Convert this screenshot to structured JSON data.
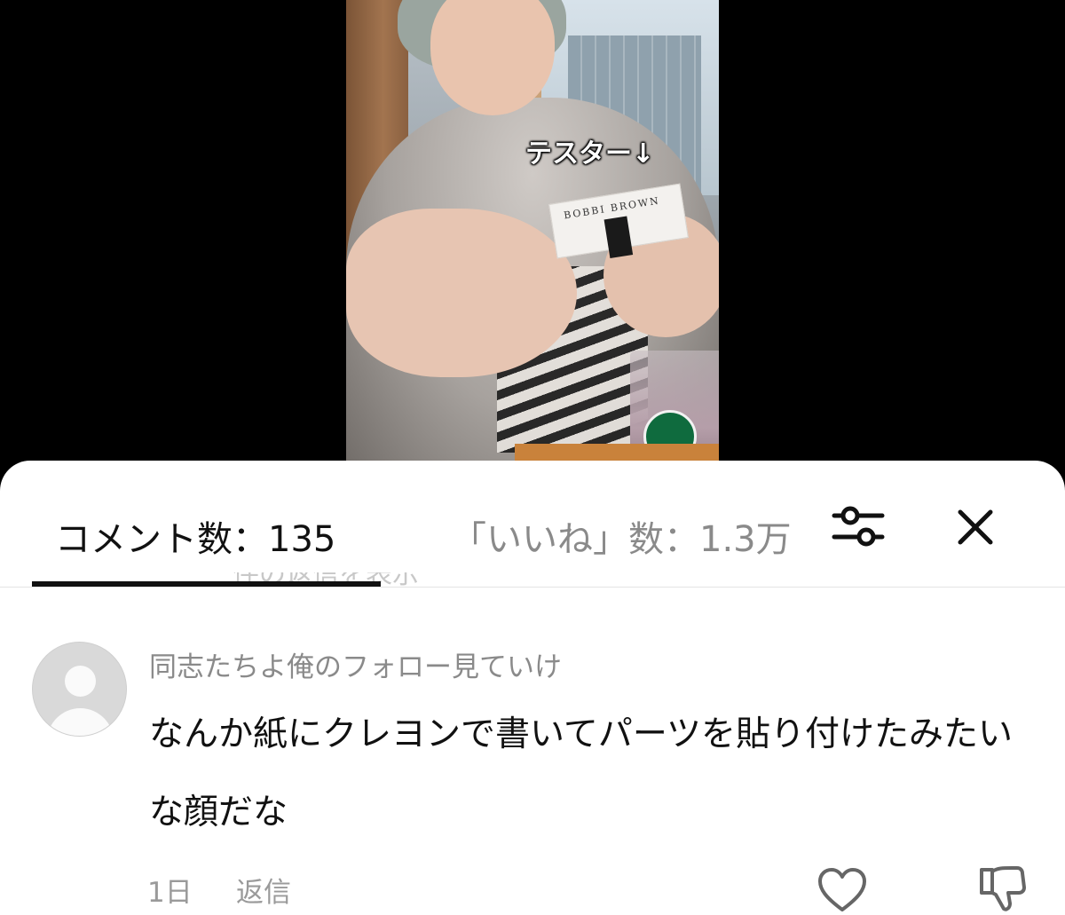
{
  "video": {
    "caption": "テスター↓",
    "card_text": "BOBBI BROWN"
  },
  "comments_sheet": {
    "tab_comments": "コメント数：135",
    "tab_likes": "「いいね」数：1.3万",
    "filter_icon": "sliders-icon",
    "close_icon": "close-icon",
    "peek_text": "件の返信を表示"
  },
  "comment": {
    "author": "同志たちよ俺のフォロー見ていけ",
    "text": "なんか紙にクレヨンで書いてパーツを貼り付けたみたいな顔だな",
    "time": "1日",
    "reply_label": "返信",
    "like_icon": "heart-icon",
    "dislike_icon": "thumbs-down-icon"
  },
  "colors": {
    "sheet_bg": "#ffffff",
    "active_tab": "#111111",
    "inactive_tab": "#8a8a8a",
    "meta_text": "#9a9a9a",
    "video_bg": "#000000"
  }
}
